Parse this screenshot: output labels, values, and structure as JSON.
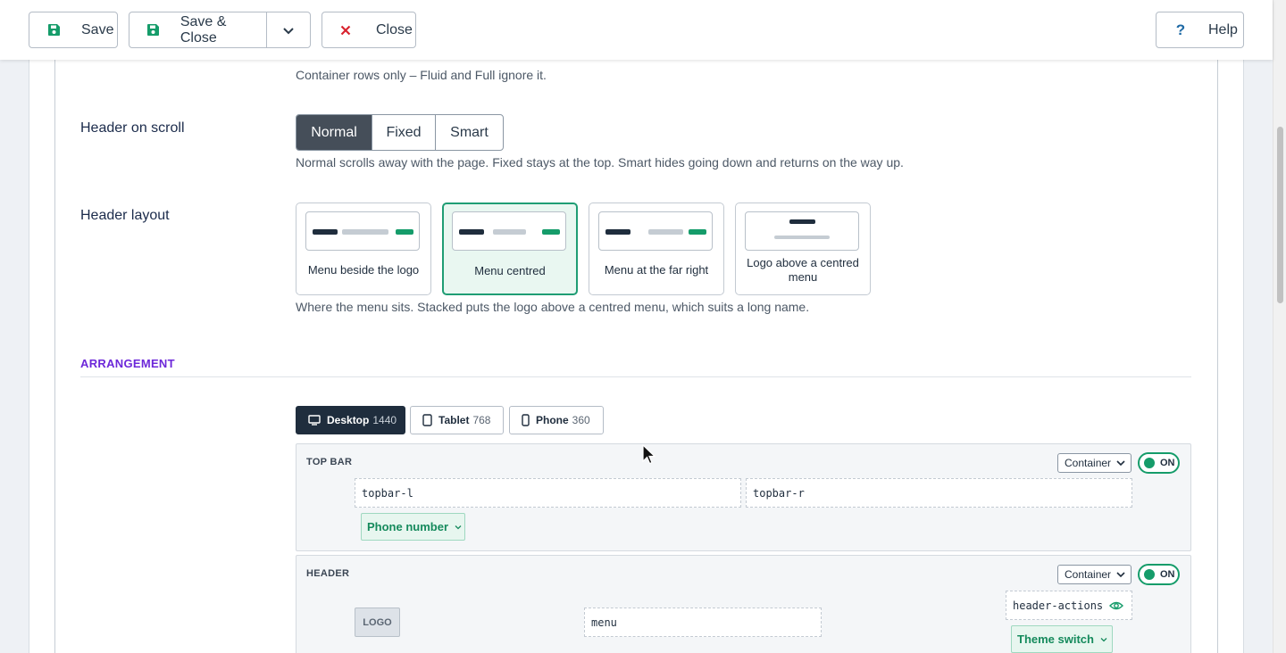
{
  "toolbar": {
    "save_label": "Save",
    "save_close_label": "Save & Close",
    "close_label": "Close",
    "help_label": "Help"
  },
  "top_help_text": "Container rows only – Fluid and Full ignore it.",
  "header_on_scroll": {
    "label": "Header on scroll",
    "options": [
      "Normal",
      "Fixed",
      "Smart"
    ],
    "selected": "Normal",
    "help": "Normal scrolls away with the page. Fixed stays at the top. Smart hides going down and returns on the way up."
  },
  "header_layout": {
    "label": "Header layout",
    "options": [
      "Menu beside the logo",
      "Menu centred",
      "Menu at the far right",
      "Logo above a centred menu"
    ],
    "selected": "Menu centred",
    "help": "Where the menu sits. Stacked puts the logo above a centred menu, which suits a long name."
  },
  "arrangement": {
    "title": "ARRANGEMENT",
    "devices": [
      {
        "label": "Desktop",
        "width": "1440",
        "active": true
      },
      {
        "label": "Tablet",
        "width": "768",
        "active": false
      },
      {
        "label": "Phone",
        "width": "360",
        "active": false
      }
    ],
    "rows": {
      "top_bar": {
        "title": "TOP BAR",
        "width_select": "Container",
        "toggle": "ON",
        "slots": [
          "topbar-l",
          "topbar-r"
        ],
        "chip": "Phone number"
      },
      "header": {
        "title": "HEADER",
        "width_select": "Container",
        "toggle": "ON",
        "logo": "LOGO",
        "menu_slot": "menu",
        "actions_slot": "header-actions",
        "chip": "Theme switch"
      }
    }
  },
  "colors": {
    "accent_green": "#159c6a",
    "section_purple": "#6d28d9",
    "active_dark": "#1f2d3d",
    "close_red": "#d9232e"
  }
}
